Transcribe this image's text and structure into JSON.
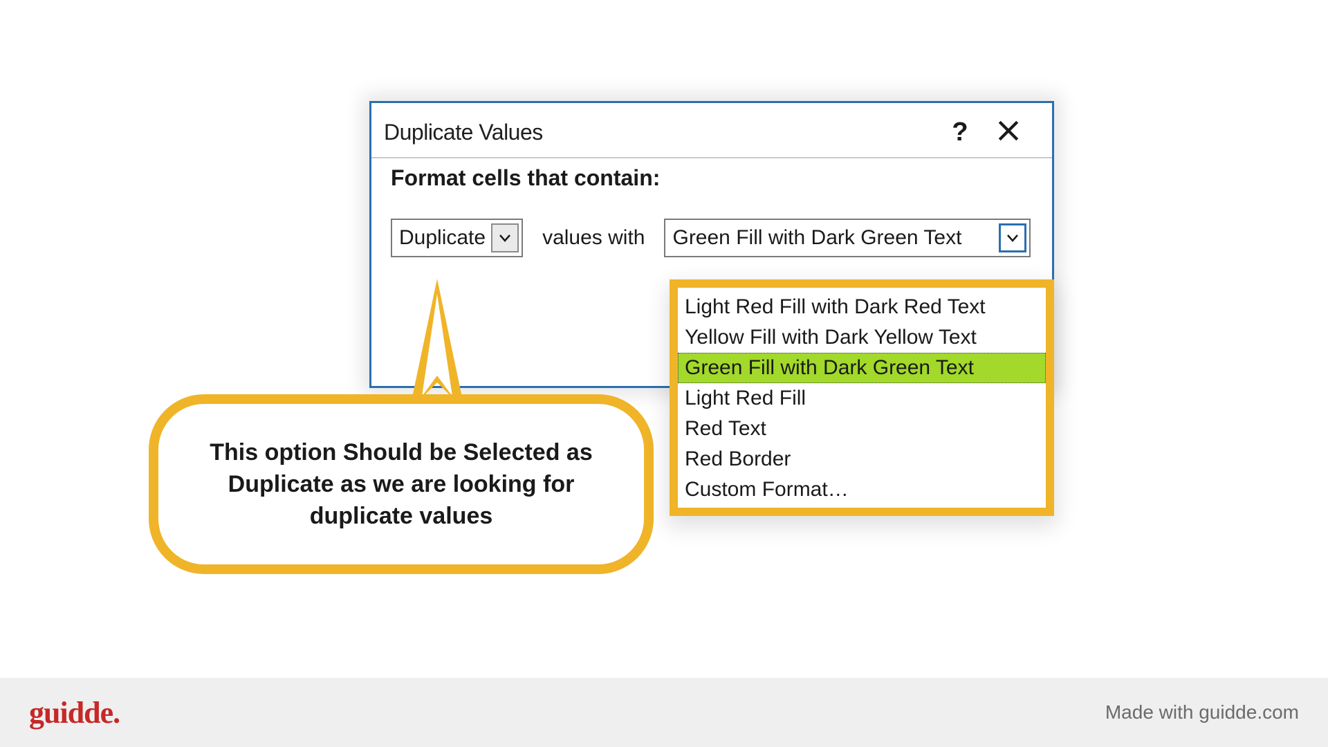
{
  "dialog": {
    "title": "Duplicate Values",
    "instruction": "Format cells that contain:",
    "type_selected": "Duplicate",
    "values_with_label": "values with",
    "format_selected": "Green Fill with Dark Green Text",
    "format_options": [
      "Light Red Fill with Dark Red Text",
      "Yellow Fill with Dark Yellow Text",
      "Green Fill with Dark Green Text",
      "Light Red Fill",
      "Red Text",
      "Red Border",
      "Custom Format…"
    ]
  },
  "annotation": {
    "text": "This option Should be Selected as Duplicate as we are looking for duplicate values"
  },
  "footer": {
    "brand": "guidde.",
    "madewith": "Made with guidde.com"
  },
  "colors": {
    "accent_blue": "#2a6fb0",
    "highlight_green": "#a2d92a",
    "callout_orange": "#f0b429",
    "brand_red": "#c62828"
  }
}
